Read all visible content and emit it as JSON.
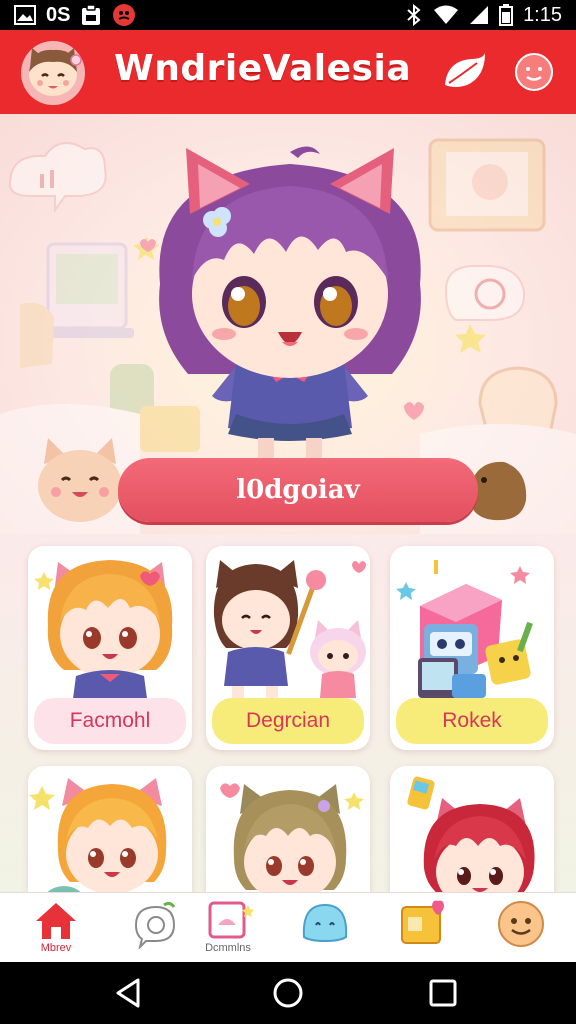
{
  "status_bar": {
    "left_label": "0S",
    "time": "1:15",
    "icons": [
      "image-icon",
      "clipboard-icon",
      "record-icon",
      "bluetooth-icon",
      "wifi-icon",
      "signal-icon",
      "battery-icon"
    ]
  },
  "app_bar": {
    "title": "WndrieValesia",
    "accent": "#ea2a2c"
  },
  "hero": {
    "banner_label": "l0dgoiav"
  },
  "cards": [
    {
      "label": "Facmohl"
    },
    {
      "label": "Degrcian"
    },
    {
      "label": "Rokek"
    },
    {
      "label": ""
    },
    {
      "label": ""
    },
    {
      "label": ""
    }
  ],
  "bottom_nav": {
    "items": [
      {
        "label": "Mbrev",
        "icon": "home-icon"
      },
      {
        "label": "",
        "icon": "chat-bubble-icon"
      },
      {
        "label": "Dcmmlns",
        "icon": "gallery-icon"
      },
      {
        "label": "",
        "icon": "slime-icon"
      },
      {
        "label": "",
        "icon": "gift-box-icon"
      },
      {
        "label": "",
        "icon": "smiley-icon"
      }
    ]
  }
}
